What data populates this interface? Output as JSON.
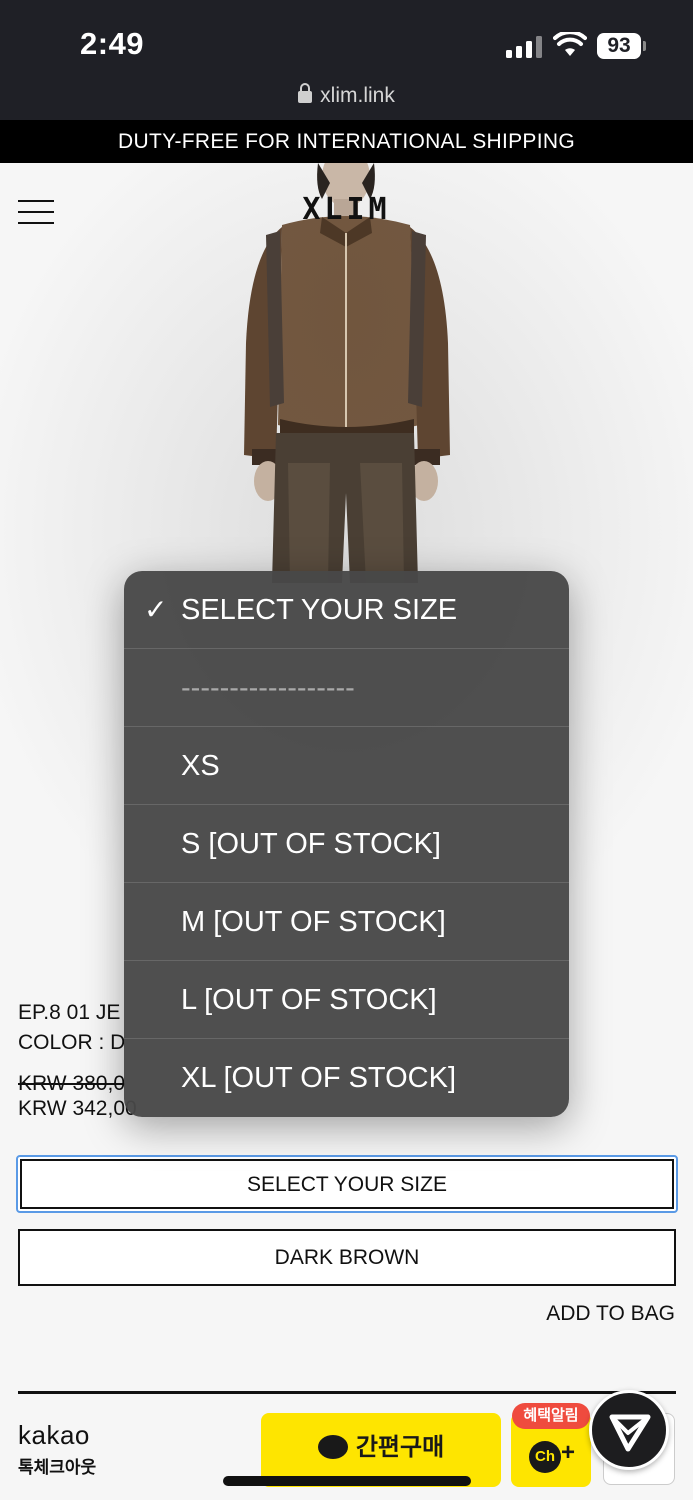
{
  "status_bar": {
    "time": "2:49",
    "battery": "93",
    "url": "xlim.link"
  },
  "promo_banner": "DUTY-FREE FOR INTERNATIONAL SHIPPING",
  "header": {
    "logo": "XLIM"
  },
  "product": {
    "name": "EP.8 01 JE",
    "color_line": "COLOR : D",
    "price_original": "KRW 380,0",
    "price_sale": "KRW 342,00"
  },
  "size_select": {
    "value": "SELECT YOUR SIZE"
  },
  "color_select": {
    "value": "DARK BROWN"
  },
  "add_to_bag": "ADD TO BAG",
  "dropdown": {
    "options": [
      {
        "label": "SELECT YOUR SIZE",
        "checked": "✓"
      },
      {
        "label": "------------------"
      },
      {
        "label": "XS"
      },
      {
        "label": "S [OUT OF STOCK]"
      },
      {
        "label": "M [OUT OF STOCK]"
      },
      {
        "label": "L [OUT OF STOCK]"
      },
      {
        "label": "XL [OUT OF STOCK]"
      }
    ]
  },
  "kakao": {
    "logo": "kakao",
    "subtitle": "톡체크아웃",
    "buy_label": "간편구매",
    "badge": "혜택알림",
    "channel_label": "Ch",
    "colors": {
      "yellow": "#fee500",
      "badge_red": "#ef4b3e"
    }
  }
}
